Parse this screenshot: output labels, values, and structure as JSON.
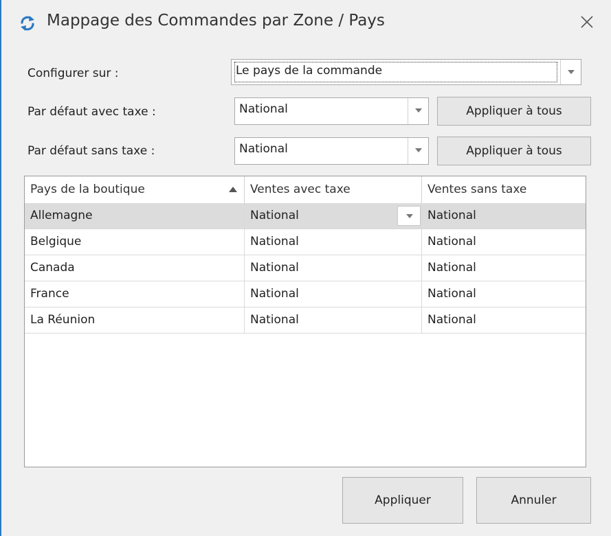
{
  "window": {
    "title": "Mappage des Commandes par Zone / Pays",
    "icon": "refresh-icon",
    "close_icon": "close-icon",
    "accent_color": "#2b79c2"
  },
  "form": {
    "configure_label": "Configurer sur :",
    "configure_value": "Le pays de la commande",
    "default_with_tax_label": "Par défaut avec taxe :",
    "default_with_tax_value": "National",
    "default_without_tax_label": "Par défaut sans taxe :",
    "default_without_tax_value": "National",
    "apply_all_label": "Appliquer à tous"
  },
  "grid": {
    "columns": [
      "Pays de la boutique",
      "Ventes avec taxe",
      "Ventes sans taxe"
    ],
    "sort_column": 0,
    "sort_direction": "ascending",
    "rows": [
      [
        "Allemagne",
        "National",
        "National"
      ],
      [
        "Belgique",
        "National",
        "National"
      ],
      [
        "Canada",
        "National",
        "National"
      ],
      [
        "France",
        "National",
        "National"
      ],
      [
        "La Réunion",
        "National",
        "National"
      ]
    ],
    "selected_row": 0
  },
  "footer": {
    "apply_label": "Appliquer",
    "cancel_label": "Annuler"
  }
}
